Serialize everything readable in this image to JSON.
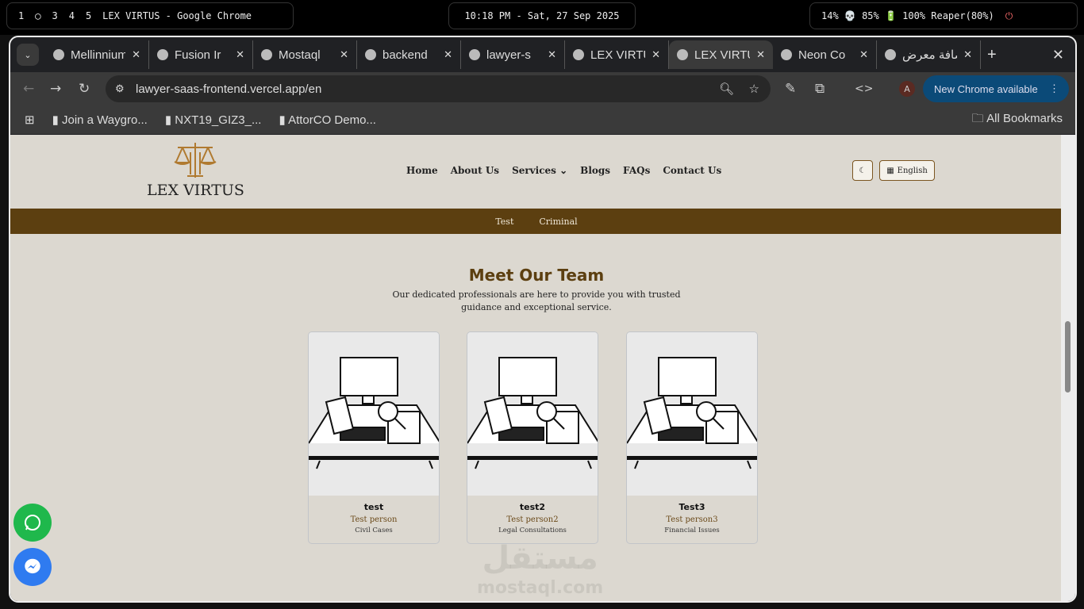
{
  "desktop": {
    "workspaces": [
      "1",
      "2",
      "3",
      "4",
      "5"
    ],
    "window_title": "LEX VIRTUS - Google Chrome",
    "clock": "10:18 PM - Sat, 27 Sep 2025",
    "status": "14% 💀 85% 🔋 100% Reaper(80%)"
  },
  "browser": {
    "tabs": [
      {
        "label": "Mellinnium"
      },
      {
        "label": "Fusion Ir"
      },
      {
        "label": "Mostaql"
      },
      {
        "label": "backend"
      },
      {
        "label": "lawyer-s"
      },
      {
        "label": "LEX VIRTUS"
      },
      {
        "label": "LEX VIRTUS",
        "active": true
      },
      {
        "label": "Neon Co"
      },
      {
        "label": "إضافة معرض"
      }
    ],
    "url": "lawyer-saas-frontend.vercel.app/en",
    "new_chrome": "New Chrome available",
    "profile": "A",
    "bookmarks": [
      "Join a Waygro...",
      "NXT19_GIZ3_...",
      "AttorCO Demo..."
    ],
    "all_bookmarks": "All Bookmarks"
  },
  "site": {
    "logo": "LEX VIRTUS",
    "nav": [
      "Home",
      "About Us",
      "Services",
      "Blogs",
      "FAQs",
      "Contact Us"
    ],
    "language": "English",
    "subnav": [
      "Test",
      "Criminal"
    ],
    "team": {
      "title": "Meet Our Team",
      "description": "Our dedicated professionals are here to provide you with trusted guidance and exceptional service.",
      "members": [
        {
          "name": "test",
          "role": "Test person",
          "specialty": "Civil Cases"
        },
        {
          "name": "test2",
          "role": "Test person2",
          "specialty": "Legal Consultations"
        },
        {
          "name": "Test3",
          "role": "Test person3",
          "specialty": "Financial Issues"
        }
      ]
    },
    "watermark": "مستقل mostaql.com"
  },
  "colors": {
    "brand": "#5c3f10",
    "bg": "#dcd8d0",
    "whatsapp": "#1fb84c",
    "messenger": "#2f7bf0"
  }
}
